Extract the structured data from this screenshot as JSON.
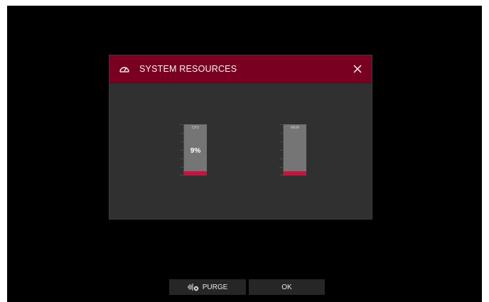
{
  "dialog": {
    "title": "SYSTEM RESOURCES",
    "header_color": "#7a0022",
    "icons": {
      "title": "gauge-icon",
      "close": "close-icon"
    }
  },
  "meters": [
    {
      "label": "CPU",
      "value_text": "9%",
      "level": 0.09,
      "fill_color": "#c7143f"
    },
    {
      "label": "MEM",
      "value_text": "",
      "level": 0.09,
      "fill_color": "#c7143f"
    }
  ],
  "buttons": {
    "purge": {
      "label": "PURGE",
      "icon": "purge-icon"
    },
    "ok": {
      "label": "OK"
    }
  }
}
